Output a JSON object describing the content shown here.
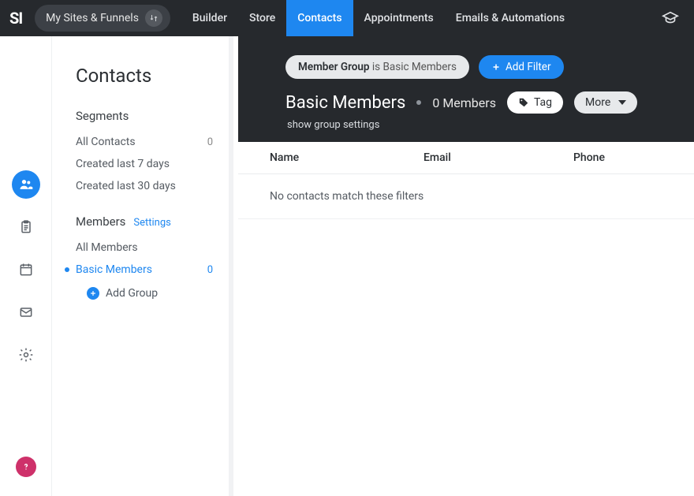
{
  "topnav": {
    "logo": "SI",
    "sites_label": "My Sites & Funnels",
    "items": [
      "Builder",
      "Store",
      "Contacts",
      "Appointments",
      "Emails & Automations"
    ],
    "active_index": 2
  },
  "sidepanel": {
    "title": "Contacts",
    "segments": {
      "heading": "Segments",
      "items": [
        {
          "label": "All Contacts",
          "count": "0"
        },
        {
          "label": "Created last 7 days",
          "count": ""
        },
        {
          "label": "Created last 30 days",
          "count": ""
        }
      ]
    },
    "members": {
      "heading": "Members",
      "settings_label": "Settings",
      "items": [
        {
          "label": "All Members",
          "count": ""
        },
        {
          "label": "Basic Members",
          "count": "0"
        }
      ],
      "active_index": 1,
      "add_label": "Add Group"
    }
  },
  "header": {
    "filter_chip_bold": "Member Group",
    "filter_chip_rest": " is Basic Members",
    "add_filter_label": "Add Filter",
    "page_title": "Basic Members",
    "member_count": "0 Members",
    "tag_label": "Tag",
    "more_label": "More",
    "sub_link": "show group settings"
  },
  "table": {
    "columns": [
      "Name",
      "Email",
      "Phone"
    ],
    "empty_text": "No contacts match these filters"
  }
}
